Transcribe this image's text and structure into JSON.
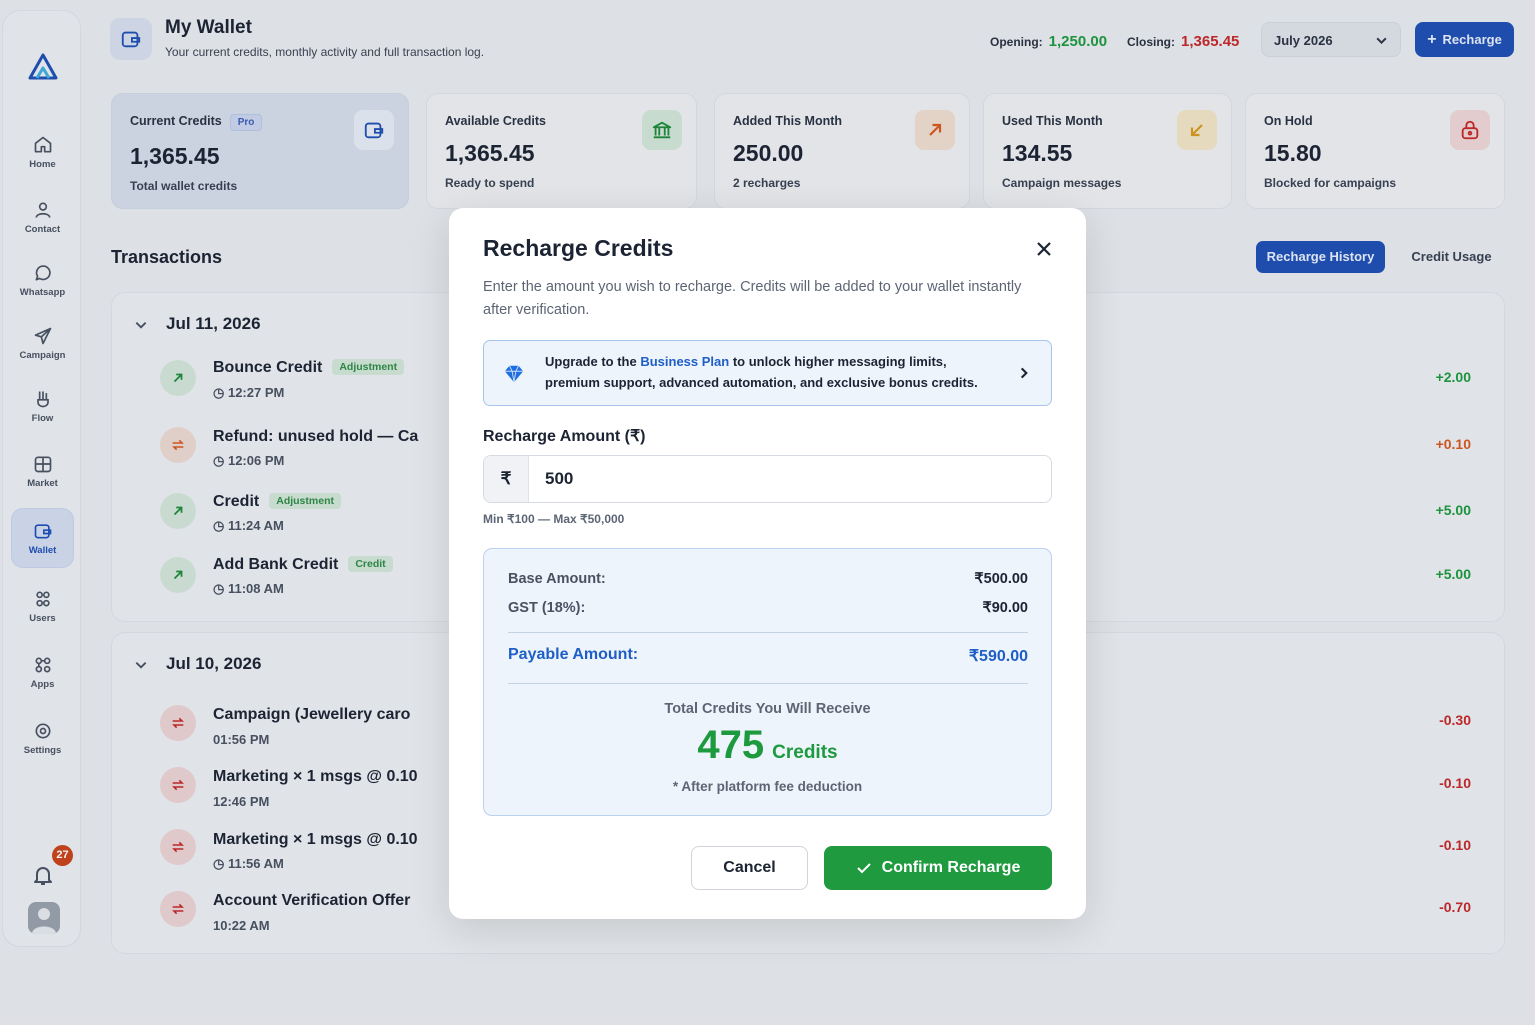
{
  "header": {
    "title": "My Wallet",
    "subtitle": "Your current credits, monthly activity and full transaction log.",
    "opening_label": "Opening:",
    "opening_value": "1,250.00",
    "closing_label": "Closing:",
    "closing_value": "1,365.45",
    "month": "July 2026",
    "recharge_label": "Recharge"
  },
  "colors": {
    "accent": "#1f4fb4",
    "positive": "#1d9a3e",
    "negative": "#c62828",
    "warning": "#d86a2a"
  },
  "sidebar": {
    "items": [
      {
        "label": "Home",
        "icon": "home-icon"
      },
      {
        "label": "Contact",
        "icon": "contact-icon"
      },
      {
        "label": "Whatsapp",
        "icon": "whatsapp-icon"
      },
      {
        "label": "Campaign",
        "icon": "send-icon"
      },
      {
        "label": "Flow",
        "icon": "flow-icon"
      },
      {
        "label": "Market",
        "icon": "market-icon"
      },
      {
        "label": "Wallet",
        "icon": "wallet-icon"
      },
      {
        "label": "Users",
        "icon": "users-icon"
      },
      {
        "label": "Apps",
        "icon": "apps-icon"
      },
      {
        "label": "Settings",
        "icon": "settings-icon"
      }
    ],
    "notification_count": "27"
  },
  "cards": [
    {
      "label": "Current Credits",
      "badge": "Pro",
      "value": "1,365.45",
      "sub": "Total wallet credits",
      "icon": "wallet-icon"
    },
    {
      "label": "Available Credits",
      "value": "1,365.45",
      "sub": "Ready to spend",
      "icon": "bank-icon"
    },
    {
      "label": "Added This Month",
      "value": "250.00",
      "sub": "2 recharges",
      "icon": "arrow-up-right-icon"
    },
    {
      "label": "Used This Month",
      "value": "134.55",
      "sub": "Campaign messages",
      "icon": "arrow-down-left-icon"
    },
    {
      "label": "On Hold",
      "value": "15.80",
      "sub": "Blocked for campaigns",
      "icon": "lock-icon"
    }
  ],
  "transactions": {
    "title": "Transactions",
    "tab_history": "Recharge History",
    "tab_usage": "Credit Usage",
    "groups": [
      {
        "date": "Jul 11, 2026",
        "rows": [
          {
            "title": "Bounce Credit",
            "tag": "Adjustment",
            "time": "12:27 PM",
            "amount": "+2.00"
          },
          {
            "title": "Refund: unused hold — Ca",
            "time": "12:06 PM",
            "amount": "+0.10"
          },
          {
            "title": "Credit",
            "tag": "Adjustment",
            "time": "11:24 AM",
            "amount": "+5.00"
          },
          {
            "title": "Add Bank Credit",
            "tag": "Credit",
            "time": "11:08 AM",
            "amount": "+5.00"
          }
        ]
      },
      {
        "date": "Jul 10, 2026",
        "rows": [
          {
            "title": "Campaign (Jewellery caro",
            "time": "01:56 PM",
            "amount": "-0.30"
          },
          {
            "title": "Marketing × 1 msgs @ 0.10",
            "time": "12:46 PM",
            "amount": "-0.10"
          },
          {
            "title": "Marketing × 1 msgs @ 0.10",
            "time": "11:56 AM",
            "amount": "-0.10"
          },
          {
            "title": "Account Verification Offer",
            "time": "10:22 AM",
            "amount": "-0.70"
          }
        ]
      }
    ]
  },
  "modal": {
    "title": "Recharge Credits",
    "description": "Enter the amount you wish to recharge. Credits will be added to your wallet instantly after verification.",
    "upgrade_pre": "Upgrade to the ",
    "upgrade_link": "Business Plan",
    "upgrade_post": " to unlock higher messaging limits, premium support, advanced automation, and exclusive bonus credits.",
    "amount_label": "Recharge Amount (₹)",
    "currency_symbol": "₹",
    "amount_value": "500",
    "amount_hint": "Min ₹100 — Max ₹50,000",
    "base_label": "Base Amount:",
    "base_value": "₹500.00",
    "gst_label": "GST (18%):",
    "gst_value": "₹90.00",
    "payable_label": "Payable Amount:",
    "payable_value": "₹590.00",
    "total_label": "Total Credits You Will Receive",
    "total_value": "475",
    "total_unit": "Credits",
    "note": "* After platform fee deduction",
    "cancel_label": "Cancel",
    "confirm_label": "Confirm Recharge"
  }
}
